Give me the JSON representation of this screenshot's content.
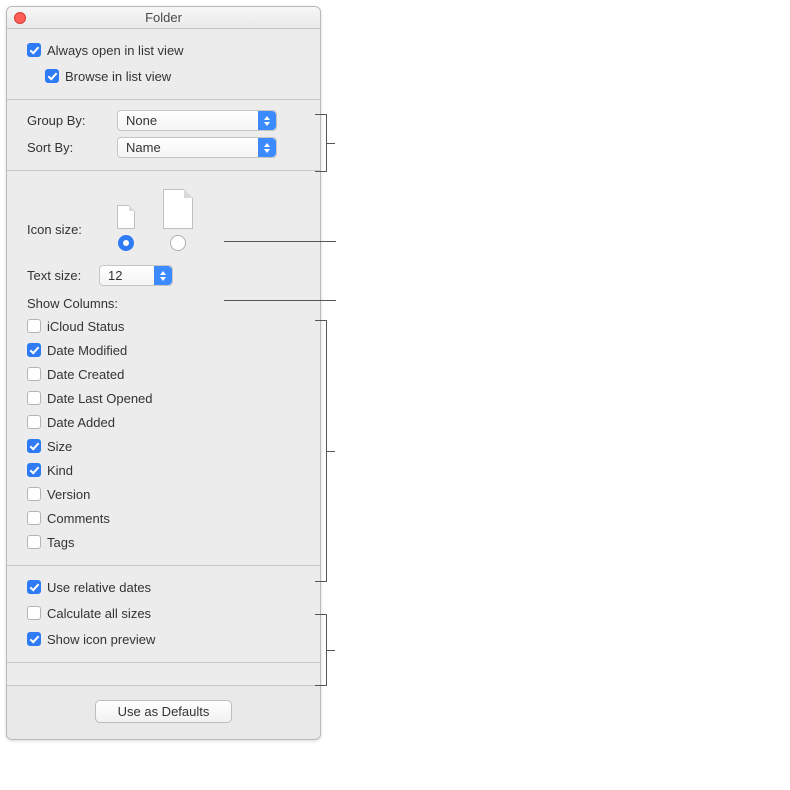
{
  "window": {
    "title": "Folder"
  },
  "view_options": {
    "always_open_list_view": {
      "label": "Always open in list view",
      "checked": true
    },
    "browse_list_view": {
      "label": "Browse in list view",
      "checked": true
    }
  },
  "group_sort": {
    "group_by": {
      "label": "Group By:",
      "value": "None"
    },
    "sort_by": {
      "label": "Sort By:",
      "value": "Name"
    }
  },
  "icon_size": {
    "label": "Icon size:",
    "selected": "small"
  },
  "text_size": {
    "label": "Text size:",
    "value": "12"
  },
  "show_columns": {
    "heading": "Show Columns:",
    "items": [
      {
        "label": "iCloud Status",
        "checked": false
      },
      {
        "label": "Date Modified",
        "checked": true
      },
      {
        "label": "Date Created",
        "checked": false
      },
      {
        "label": "Date Last Opened",
        "checked": false
      },
      {
        "label": "Date Added",
        "checked": false
      },
      {
        "label": "Size",
        "checked": true
      },
      {
        "label": "Kind",
        "checked": true
      },
      {
        "label": "Version",
        "checked": false
      },
      {
        "label": "Comments",
        "checked": false
      },
      {
        "label": "Tags",
        "checked": false
      }
    ]
  },
  "bottom_options": {
    "use_relative_dates": {
      "label": "Use relative dates",
      "checked": true
    },
    "calculate_all_sizes": {
      "label": "Calculate all sizes",
      "checked": false
    },
    "show_icon_preview": {
      "label": "Show icon preview",
      "checked": true
    }
  },
  "footer": {
    "use_as_defaults": "Use as Defaults"
  }
}
